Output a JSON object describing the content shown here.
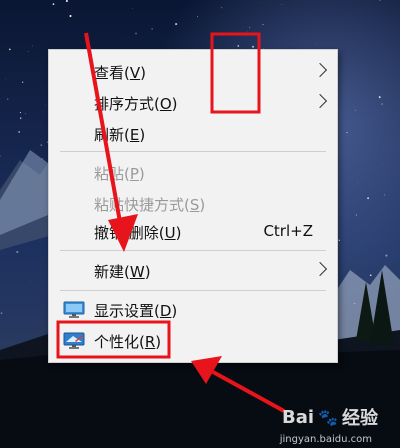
{
  "menu": {
    "items": [
      {
        "label": "查看(",
        "key": "V",
        "suffix": ")",
        "submenu": true,
        "disabled": false
      },
      {
        "label": "排序方式(",
        "key": "O",
        "suffix": ")",
        "submenu": true,
        "disabled": false
      },
      {
        "label": "刷新(",
        "key": "E",
        "suffix": ")",
        "submenu": false,
        "disabled": false
      },
      {
        "label": "粘贴(",
        "key": "P",
        "suffix": ")",
        "submenu": false,
        "disabled": true
      },
      {
        "label": "粘贴快捷方式(",
        "key": "S",
        "suffix": ")",
        "submenu": false,
        "disabled": true
      },
      {
        "label": "撤销 删除(",
        "key": "U",
        "suffix": ")",
        "shortcut": "Ctrl+Z",
        "submenu": false,
        "disabled": false
      },
      {
        "label": "新建(",
        "key": "W",
        "suffix": ")",
        "submenu": true,
        "disabled": false
      },
      {
        "label": "显示设置(",
        "key": "D",
        "suffix": ")",
        "icon": "display-settings-icon",
        "submenu": false,
        "disabled": false
      },
      {
        "label": "个性化(",
        "key": "R",
        "suffix": ")",
        "icon": "personalize-icon",
        "submenu": false,
        "disabled": false
      }
    ]
  },
  "watermark": {
    "brand": "Bai",
    "brand2": "经验",
    "url": "jingyan.baidu.com"
  },
  "colors": {
    "annotation": "#e8141b",
    "menu_bg": "#f2f2f2",
    "disabled_text": "#9a9a9a"
  }
}
